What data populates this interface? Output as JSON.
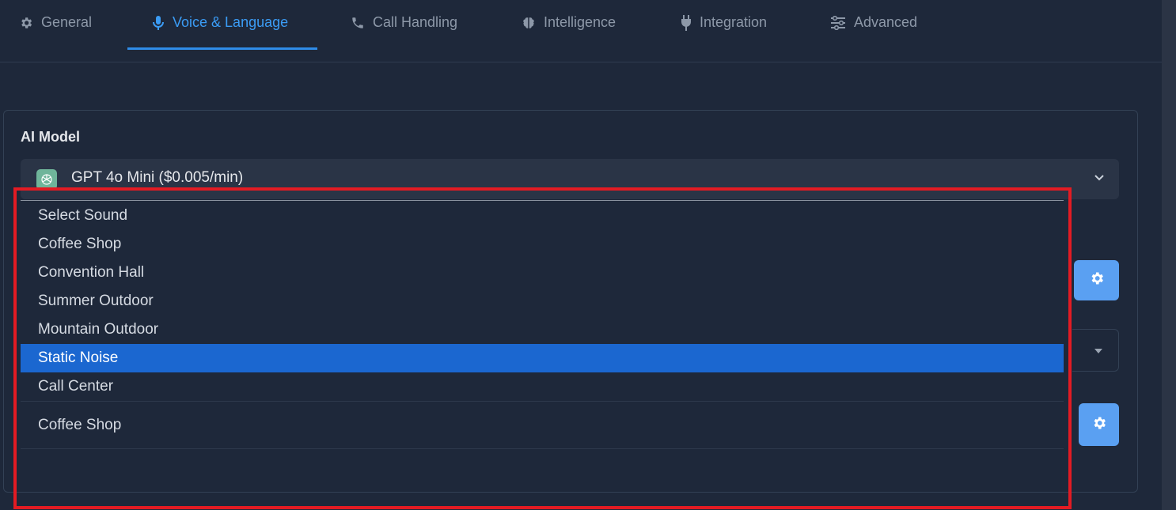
{
  "tabs": [
    {
      "label": "General",
      "icon": "gear-icon",
      "active": false
    },
    {
      "label": "Voice & Language",
      "icon": "microphone-icon",
      "active": true
    },
    {
      "label": "Call Handling",
      "icon": "phone-icon",
      "active": false
    },
    {
      "label": "Intelligence",
      "icon": "brain-icon",
      "active": false
    },
    {
      "label": "Integration",
      "icon": "plug-icon",
      "active": false
    },
    {
      "label": "Advanced",
      "icon": "sliders-icon",
      "active": false
    }
  ],
  "ai_model": {
    "title": "AI Model",
    "selected": "GPT 4o Mini ($0.005/min)",
    "icon": "openai-icon"
  },
  "sound_dropdown": {
    "options": [
      "Select Sound",
      "Coffee Shop",
      "Convention Hall",
      "Summer Outdoor",
      "Mountain Outdoor",
      "Static Noise",
      "Call Center"
    ],
    "highlighted": "Static Noise"
  },
  "background_sound_value": "Coffee Shop",
  "colors": {
    "background": "#1e283a",
    "accent": "#3b9cf5",
    "selected_option": "#1b67d0",
    "gear_button": "#5aa0f2",
    "highlight_box": "#e31b23"
  }
}
